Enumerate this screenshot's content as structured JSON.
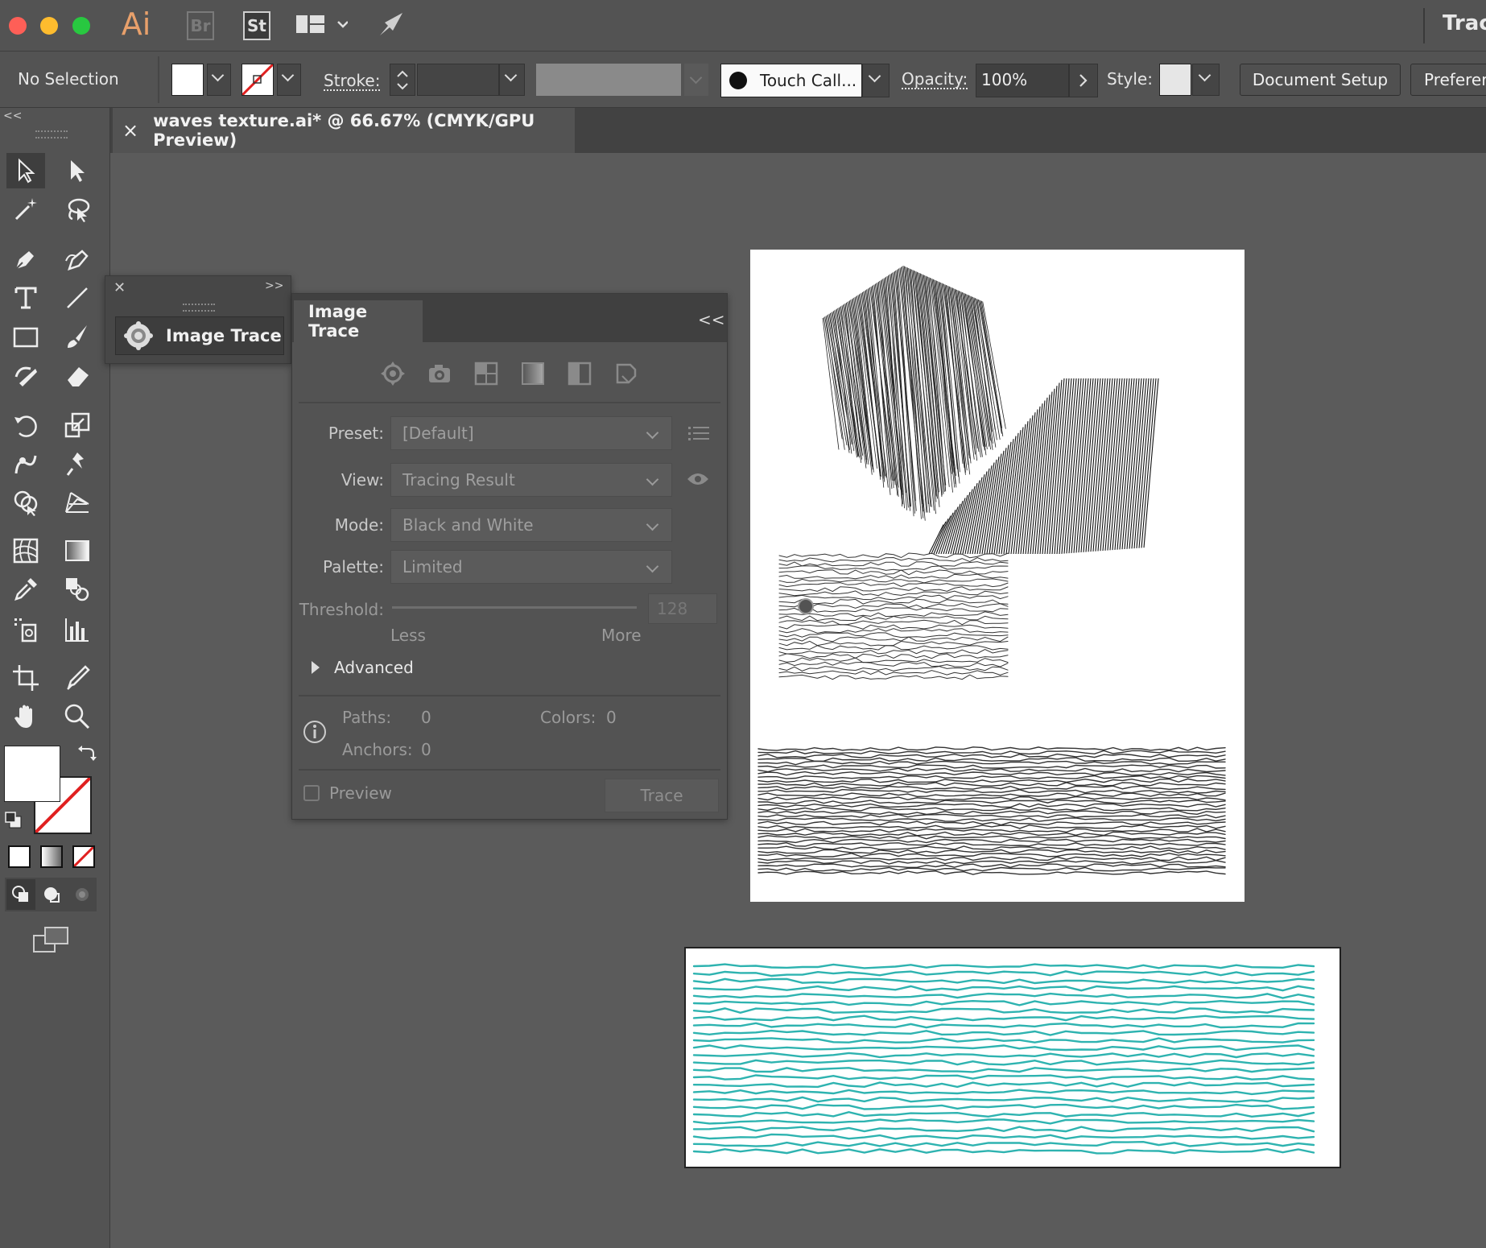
{
  "appbar": {
    "app_icon": "Ai",
    "bridge_icon": "Br",
    "stock_icon": "St",
    "workspace_title": "Trac"
  },
  "control_bar": {
    "selection_status": "No Selection",
    "stroke_label": "Stroke:",
    "brush_name": "Touch Call...",
    "opacity_label": "Opacity:",
    "opacity_value": "100%",
    "style_label": "Style:",
    "document_setup": "Document Setup",
    "preferences": "Preferer"
  },
  "document_tab": {
    "close": "×",
    "title": "waves texture.ai* @ 66.67% (CMYK/GPU Preview)"
  },
  "collapsed_panel": {
    "item_label": "Image Trace"
  },
  "image_trace": {
    "title": "Image Trace",
    "preset_label": "Preset:",
    "preset_value": "[Default]",
    "view_label": "View:",
    "view_value": "Tracing Result",
    "mode_label": "Mode:",
    "mode_value": "Black and White",
    "palette_label": "Palette:",
    "palette_value": "Limited",
    "threshold_label": "Threshold:",
    "threshold_value": "128",
    "threshold_fraction": 0.5,
    "less_label": "Less",
    "more_label": "More",
    "advanced_label": "Advanced",
    "paths_label": "Paths:",
    "paths_value": "0",
    "colors_label": "Colors:",
    "colors_value": "0",
    "anchors_label": "Anchors:",
    "anchors_value": "0",
    "preview_label": "Preview",
    "trace_button": "Trace"
  },
  "colors": {
    "teal_waves": "#2eb3b0",
    "traffic_red": "#fe5f57",
    "traffic_yellow": "#febc2e",
    "traffic_green": "#28c840"
  }
}
